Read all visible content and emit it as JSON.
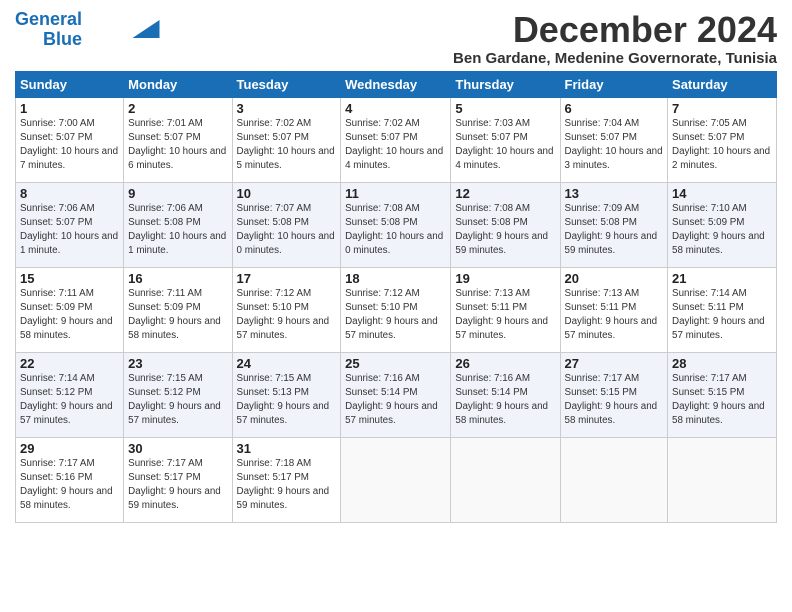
{
  "logo": {
    "line1": "General",
    "line2": "Blue"
  },
  "title": "December 2024",
  "location": "Ben Gardane, Medenine Governorate, Tunisia",
  "days_of_week": [
    "Sunday",
    "Monday",
    "Tuesday",
    "Wednesday",
    "Thursday",
    "Friday",
    "Saturday"
  ],
  "weeks": [
    [
      {
        "day": "1",
        "sunrise": "7:00 AM",
        "sunset": "5:07 PM",
        "daylight": "10 hours and 7 minutes."
      },
      {
        "day": "2",
        "sunrise": "7:01 AM",
        "sunset": "5:07 PM",
        "daylight": "10 hours and 6 minutes."
      },
      {
        "day": "3",
        "sunrise": "7:02 AM",
        "sunset": "5:07 PM",
        "daylight": "10 hours and 5 minutes."
      },
      {
        "day": "4",
        "sunrise": "7:02 AM",
        "sunset": "5:07 PM",
        "daylight": "10 hours and 4 minutes."
      },
      {
        "day": "5",
        "sunrise": "7:03 AM",
        "sunset": "5:07 PM",
        "daylight": "10 hours and 4 minutes."
      },
      {
        "day": "6",
        "sunrise": "7:04 AM",
        "sunset": "5:07 PM",
        "daylight": "10 hours and 3 minutes."
      },
      {
        "day": "7",
        "sunrise": "7:05 AM",
        "sunset": "5:07 PM",
        "daylight": "10 hours and 2 minutes."
      }
    ],
    [
      {
        "day": "8",
        "sunrise": "7:06 AM",
        "sunset": "5:07 PM",
        "daylight": "10 hours and 1 minute."
      },
      {
        "day": "9",
        "sunrise": "7:06 AM",
        "sunset": "5:08 PM",
        "daylight": "10 hours and 1 minute."
      },
      {
        "day": "10",
        "sunrise": "7:07 AM",
        "sunset": "5:08 PM",
        "daylight": "10 hours and 0 minutes."
      },
      {
        "day": "11",
        "sunrise": "7:08 AM",
        "sunset": "5:08 PM",
        "daylight": "10 hours and 0 minutes."
      },
      {
        "day": "12",
        "sunrise": "7:08 AM",
        "sunset": "5:08 PM",
        "daylight": "9 hours and 59 minutes."
      },
      {
        "day": "13",
        "sunrise": "7:09 AM",
        "sunset": "5:08 PM",
        "daylight": "9 hours and 59 minutes."
      },
      {
        "day": "14",
        "sunrise": "7:10 AM",
        "sunset": "5:09 PM",
        "daylight": "9 hours and 58 minutes."
      }
    ],
    [
      {
        "day": "15",
        "sunrise": "7:11 AM",
        "sunset": "5:09 PM",
        "daylight": "9 hours and 58 minutes."
      },
      {
        "day": "16",
        "sunrise": "7:11 AM",
        "sunset": "5:09 PM",
        "daylight": "9 hours and 58 minutes."
      },
      {
        "day": "17",
        "sunrise": "7:12 AM",
        "sunset": "5:10 PM",
        "daylight": "9 hours and 57 minutes."
      },
      {
        "day": "18",
        "sunrise": "7:12 AM",
        "sunset": "5:10 PM",
        "daylight": "9 hours and 57 minutes."
      },
      {
        "day": "19",
        "sunrise": "7:13 AM",
        "sunset": "5:11 PM",
        "daylight": "9 hours and 57 minutes."
      },
      {
        "day": "20",
        "sunrise": "7:13 AM",
        "sunset": "5:11 PM",
        "daylight": "9 hours and 57 minutes."
      },
      {
        "day": "21",
        "sunrise": "7:14 AM",
        "sunset": "5:11 PM",
        "daylight": "9 hours and 57 minutes."
      }
    ],
    [
      {
        "day": "22",
        "sunrise": "7:14 AM",
        "sunset": "5:12 PM",
        "daylight": "9 hours and 57 minutes."
      },
      {
        "day": "23",
        "sunrise": "7:15 AM",
        "sunset": "5:12 PM",
        "daylight": "9 hours and 57 minutes."
      },
      {
        "day": "24",
        "sunrise": "7:15 AM",
        "sunset": "5:13 PM",
        "daylight": "9 hours and 57 minutes."
      },
      {
        "day": "25",
        "sunrise": "7:16 AM",
        "sunset": "5:14 PM",
        "daylight": "9 hours and 57 minutes."
      },
      {
        "day": "26",
        "sunrise": "7:16 AM",
        "sunset": "5:14 PM",
        "daylight": "9 hours and 58 minutes."
      },
      {
        "day": "27",
        "sunrise": "7:17 AM",
        "sunset": "5:15 PM",
        "daylight": "9 hours and 58 minutes."
      },
      {
        "day": "28",
        "sunrise": "7:17 AM",
        "sunset": "5:15 PM",
        "daylight": "9 hours and 58 minutes."
      }
    ],
    [
      {
        "day": "29",
        "sunrise": "7:17 AM",
        "sunset": "5:16 PM",
        "daylight": "9 hours and 58 minutes."
      },
      {
        "day": "30",
        "sunrise": "7:17 AM",
        "sunset": "5:17 PM",
        "daylight": "9 hours and 59 minutes."
      },
      {
        "day": "31",
        "sunrise": "7:18 AM",
        "sunset": "5:17 PM",
        "daylight": "9 hours and 59 minutes."
      },
      null,
      null,
      null,
      null
    ]
  ]
}
